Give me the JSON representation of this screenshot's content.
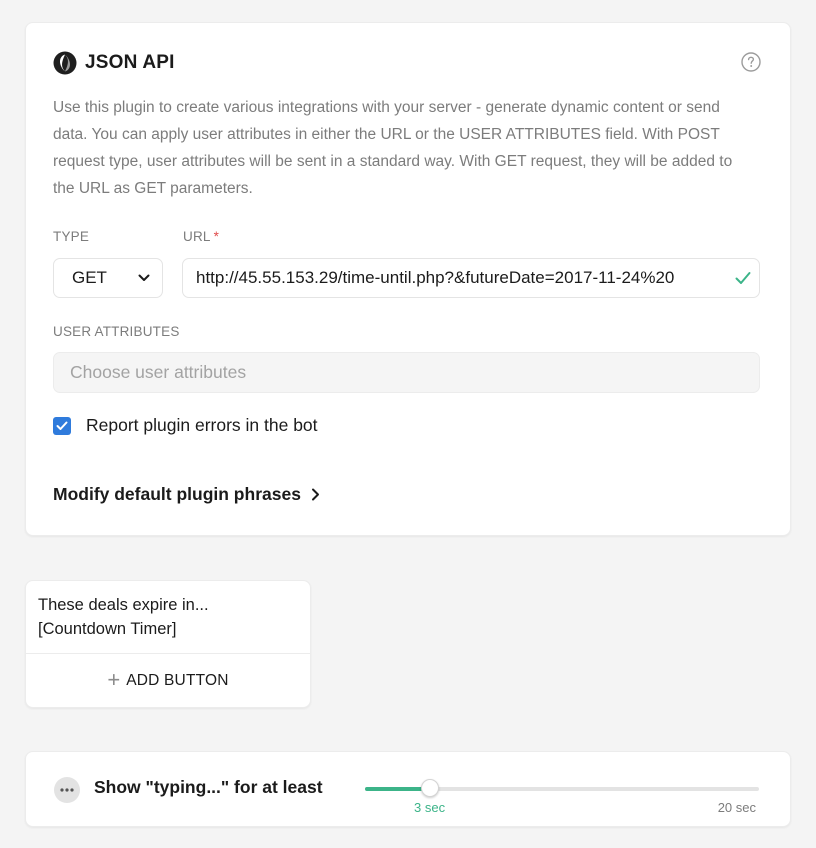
{
  "plugin": {
    "title": "JSON API",
    "icon": "json-api-icon",
    "help_icon": "question-circle-icon",
    "description": "Use this plugin to create various integrations with your server - generate dynamic content or send data. You can apply user attributes in either the URL or the USER ATTRIBUTES field. With POST request type, user attributes will be sent in a standard way. With GET request, they will be added to the URL as GET parameters.",
    "type_label": "TYPE",
    "type_value": "GET",
    "url_label": "URL",
    "url_required_mark": "*",
    "url_value": "http://45.55.153.29/time-until.php?&futureDate=2017-11-24%20",
    "user_attributes_label": "USER ATTRIBUTES",
    "user_attributes_placeholder": "Choose user attributes",
    "report_errors_label": "Report plugin errors in the bot",
    "report_errors_checked": true,
    "modify_phrases_label": "Modify default plugin phrases"
  },
  "text_card": {
    "message": "These deals expire in... [Countdown Timer]",
    "add_button_label": "ADD BUTTON"
  },
  "typing": {
    "label": "Show \"typing...\" for at least",
    "slider_min_label": "3 sec",
    "slider_max_label": "20 sec",
    "slider_fraction": 0.165
  },
  "colors": {
    "accent_green": "#3cb489",
    "checkbox_blue": "#2f7bdc",
    "required_red": "#e04b4b"
  }
}
